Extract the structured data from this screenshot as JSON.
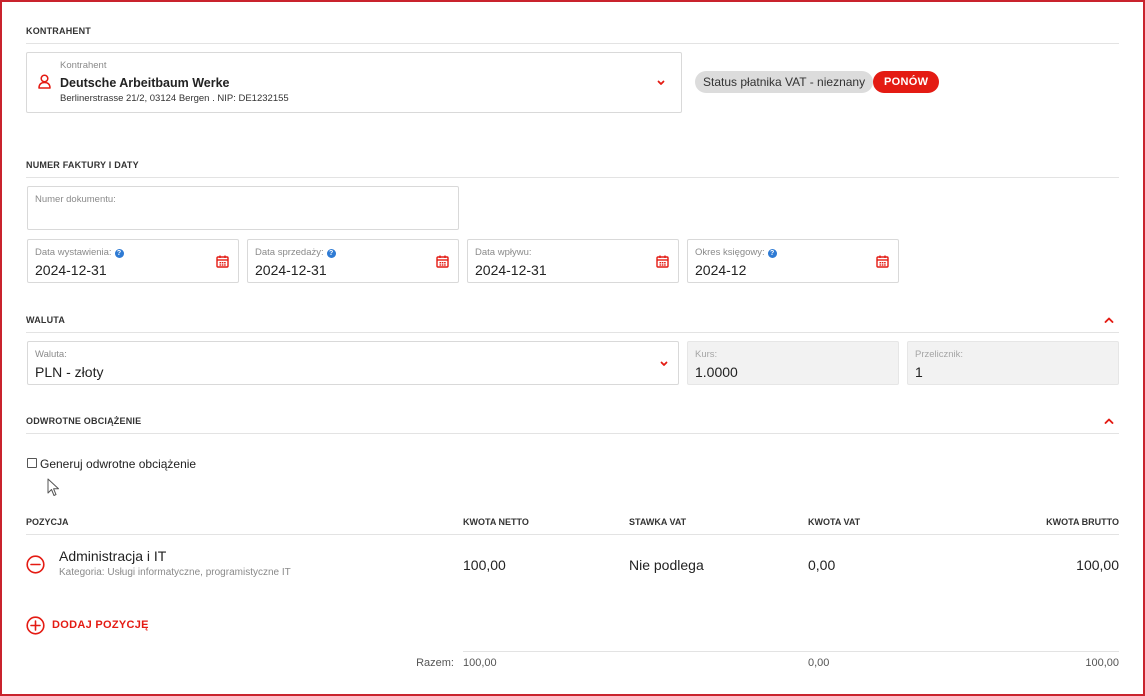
{
  "sections": {
    "contractor": "KONTRAHENT",
    "invoice": "NUMER FAKTURY I DATY",
    "currency": "WALUTA",
    "reverse": "ODWROTNE OBCIĄŻENIE"
  },
  "contractor": {
    "label": "Kontrahent",
    "name": "Deutsche Arbeitbaum Werke",
    "address": "Berlinerstrasse 21/2, 03124 Bergen . NIP: DE1232155",
    "vat_status": "Status płatnika VAT - nieznany",
    "retry_label": "PONÓW"
  },
  "invoice": {
    "doc_number": {
      "label": "Numer dokumentu:",
      "value": ""
    },
    "issue_date": {
      "label": "Data wystawienia:",
      "value": "2024-12-31"
    },
    "sale_date": {
      "label": "Data sprzedaży:",
      "value": "2024-12-31"
    },
    "receipt_date": {
      "label": "Data wpływu:",
      "value": "2024-12-31"
    },
    "period": {
      "label": "Okres księgowy:",
      "value": "2024-12"
    }
  },
  "currency": {
    "currency": {
      "label": "Waluta:",
      "value": "PLN - złoty"
    },
    "rate": {
      "label": "Kurs:",
      "value": "1.0000"
    },
    "converter": {
      "label": "Przelicznik:",
      "value": "1"
    }
  },
  "reverse": {
    "checkbox_label": "Generuj odwrotne obciążenie",
    "checked": false
  },
  "table": {
    "headers": {
      "position": "POZYCJA",
      "net": "KWOTA NETTO",
      "vat_rate": "STAWKA VAT",
      "vat_amount": "KWOTA VAT",
      "gross": "KWOTA BRUTTO"
    },
    "rows": [
      {
        "name": "Administracja i IT",
        "category": "Kategoria: Usługi informatyczne, programistyczne IT",
        "net": "100,00",
        "vat_rate": "Nie podlega",
        "vat_amount": "0,00",
        "gross": "100,00"
      }
    ],
    "add_label": "DODAJ POZYCJĘ",
    "totals": {
      "label": "Razem:",
      "net": "100,00",
      "vat_amount": "0,00",
      "gross": "100,00"
    }
  },
  "colors": {
    "accent": "#e41b13",
    "frame": "#c9232d",
    "help": "#2f7bd4"
  }
}
